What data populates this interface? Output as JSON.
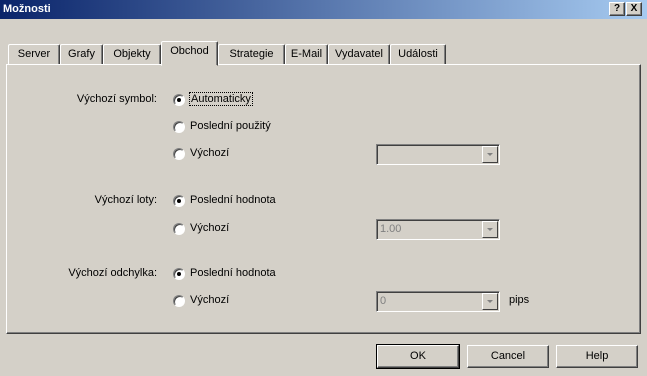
{
  "window": {
    "title": "Možnosti",
    "help_label": "?",
    "close_label": "X"
  },
  "tabs": [
    {
      "label": "Server"
    },
    {
      "label": "Grafy"
    },
    {
      "label": "Objekty"
    },
    {
      "label": "Obchod",
      "active": true
    },
    {
      "label": "Strategie"
    },
    {
      "label": "E-Mail"
    },
    {
      "label": "Vydavatel"
    },
    {
      "label": "Události"
    }
  ],
  "symbol": {
    "label": "Výchozí symbol:",
    "options": [
      "Automaticky",
      "Poslední použitý",
      "Výchozí"
    ],
    "selected": "Automaticky",
    "combo_value": ""
  },
  "lots": {
    "label": "Výchozí loty:",
    "options": [
      "Poslední hodnota",
      "Výchozí"
    ],
    "selected": "Poslední hodnota",
    "combo_value": "1.00"
  },
  "deviation": {
    "label": "Výchozí odchylka:",
    "options": [
      "Poslední hodnota",
      "Výchozí"
    ],
    "selected": "Poslední hodnota",
    "combo_value": "0",
    "unit": "pips"
  },
  "buttons": {
    "ok": "OK",
    "cancel": "Cancel",
    "help": "Help"
  }
}
